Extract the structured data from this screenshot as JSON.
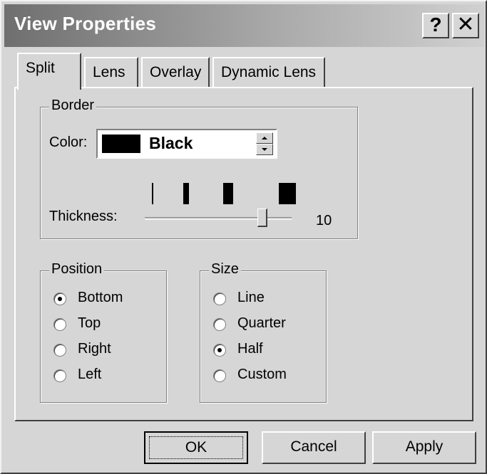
{
  "window": {
    "title": "View Properties",
    "help_glyph": "?",
    "close_glyph": "✕"
  },
  "tabs": [
    {
      "label": "Split",
      "active": true
    },
    {
      "label": "Lens",
      "active": false
    },
    {
      "label": "Overlay",
      "active": false
    },
    {
      "label": "Dynamic Lens",
      "active": false
    }
  ],
  "border_group": {
    "label": "Border",
    "color_label": "Color:",
    "color_value": "Black",
    "swatch_color": "#000000",
    "thickness_label": "Thickness:",
    "thickness_value": "10"
  },
  "position_group": {
    "label": "Position",
    "options": [
      {
        "label": "Bottom",
        "checked": true
      },
      {
        "label": "Top",
        "checked": false
      },
      {
        "label": "Right",
        "checked": false
      },
      {
        "label": "Left",
        "checked": false
      }
    ]
  },
  "size_group": {
    "label": "Size",
    "options": [
      {
        "label": "Line",
        "checked": false
      },
      {
        "label": "Quarter",
        "checked": false
      },
      {
        "label": "Half",
        "checked": true
      },
      {
        "label": "Custom",
        "checked": false
      }
    ]
  },
  "buttons": {
    "ok": "OK",
    "cancel": "Cancel",
    "apply": "Apply"
  }
}
